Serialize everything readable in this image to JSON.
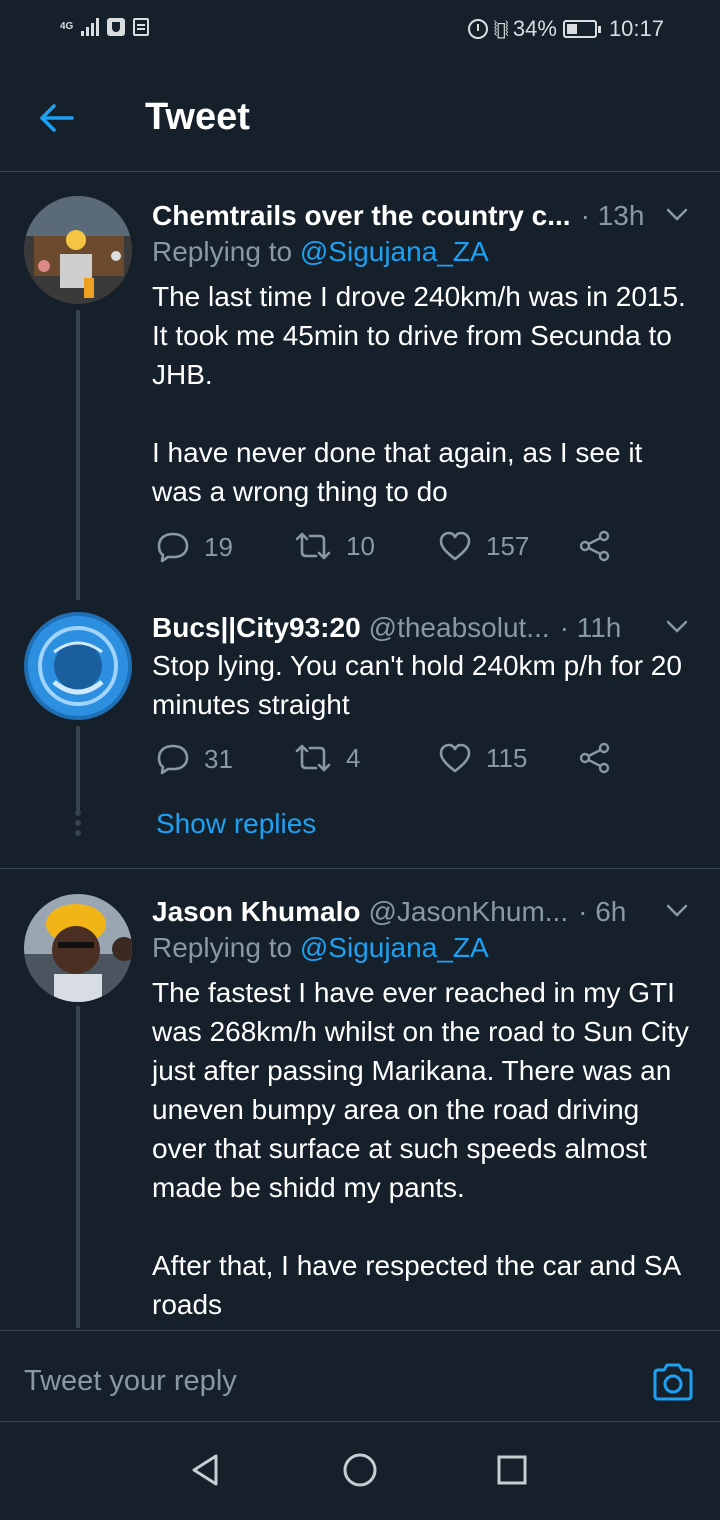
{
  "status_bar": {
    "network": "4G",
    "battery": "34%",
    "time": "10:17"
  },
  "header": {
    "title": "Tweet"
  },
  "tweets": [
    {
      "name": "Chemtrails over the country c...",
      "handle": "",
      "time": "· 13h",
      "replying_prefix": "Replying to ",
      "replying_to": "@Sigujana_ZA",
      "text": "The last time I drove 240km/h was in 2015. It took me 45min to drive from Secunda to JHB.\n\nI have never done that again, as I see it was a wrong thing to do",
      "replies": "19",
      "retweets": "10",
      "likes": "157"
    },
    {
      "name": "Bucs||City93:20",
      "handle": "@theabsolut...",
      "time": "· 11h",
      "text": "Stop lying. You can't hold 240km p/h for 20 minutes straight",
      "replies": "31",
      "retweets": "4",
      "likes": "115"
    },
    {
      "name": "Jason Khumalo",
      "handle": "@JasonKhum...",
      "time": "· 6h",
      "replying_prefix": "Replying to ",
      "replying_to": "@Sigujana_ZA",
      "text": "The fastest I have ever reached in my GTI was 268km/h whilst on the road to Sun City just after passing Marikana. There was an uneven bumpy area on the road driving over that surface at such speeds almost made be shidd my pants.\n\nAfter that, I have respected the car and SA roads"
    }
  ],
  "show_replies": "Show replies",
  "composer": {
    "placeholder": "Tweet your reply"
  },
  "icons": {
    "accent": "#1da1f2",
    "muted": "#8899a6",
    "background": "#15202b",
    "border": "#38444d"
  }
}
